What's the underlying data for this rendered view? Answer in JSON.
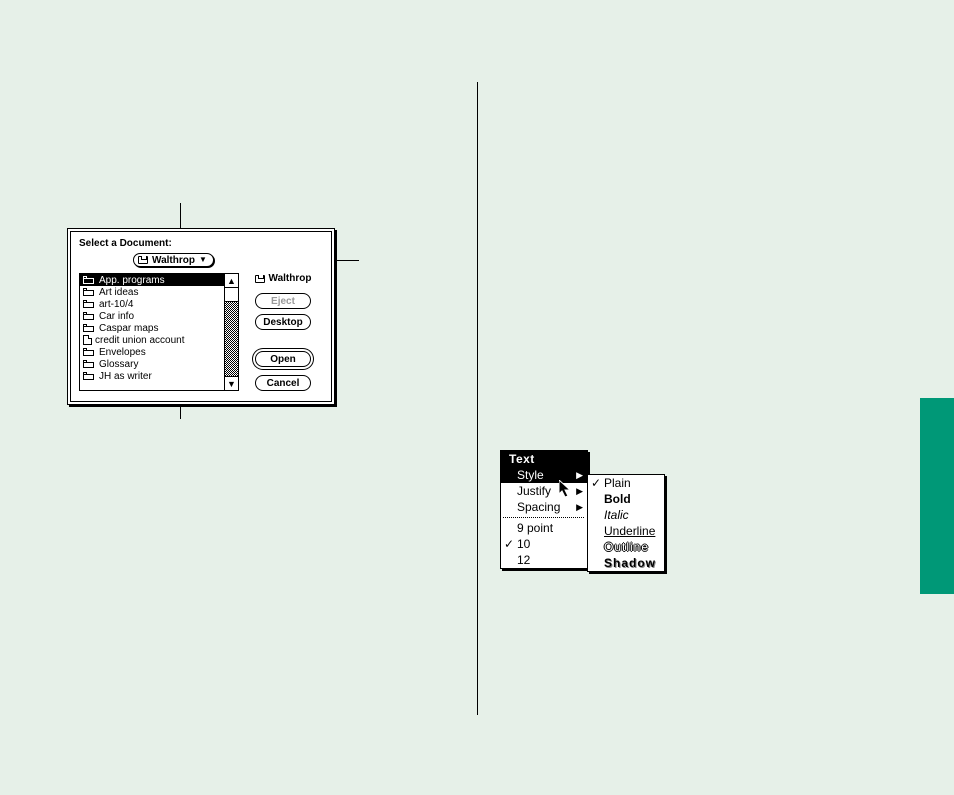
{
  "dialog": {
    "title": "Select a Document:",
    "popup_folder": "Walthrop",
    "disk_label": "Walthrop",
    "items": [
      {
        "type": "folder",
        "label": "App. programs",
        "selected": true
      },
      {
        "type": "folder",
        "label": "Art ideas"
      },
      {
        "type": "folder",
        "label": "art-10/4"
      },
      {
        "type": "folder",
        "label": "Car info"
      },
      {
        "type": "folder",
        "label": "Caspar maps"
      },
      {
        "type": "doc",
        "label": "credit union account"
      },
      {
        "type": "folder",
        "label": "Envelopes"
      },
      {
        "type": "folder",
        "label": "Glossary"
      },
      {
        "type": "folder",
        "label": "JH as writer"
      }
    ],
    "buttons": {
      "eject": "Eject",
      "desktop": "Desktop",
      "open": "Open",
      "cancel": "Cancel"
    }
  },
  "text_menu": {
    "title": "Text",
    "items": [
      {
        "label": "Style",
        "submenu": true,
        "selected": true
      },
      {
        "label": "Justify",
        "submenu": true
      },
      {
        "label": "Spacing",
        "submenu": true
      }
    ],
    "sizes": [
      {
        "label": "9 point"
      },
      {
        "label": "10",
        "checked": true
      },
      {
        "label": "12"
      }
    ],
    "style_submenu": [
      {
        "label": "Plain",
        "checked": true,
        "style": "plain"
      },
      {
        "label": "Bold",
        "style": "bold"
      },
      {
        "label": "Italic",
        "style": "italic"
      },
      {
        "label": "Underline",
        "style": "underline"
      },
      {
        "label": "Outline",
        "style": "outline"
      },
      {
        "label": "Shadow",
        "style": "shadow"
      }
    ]
  }
}
